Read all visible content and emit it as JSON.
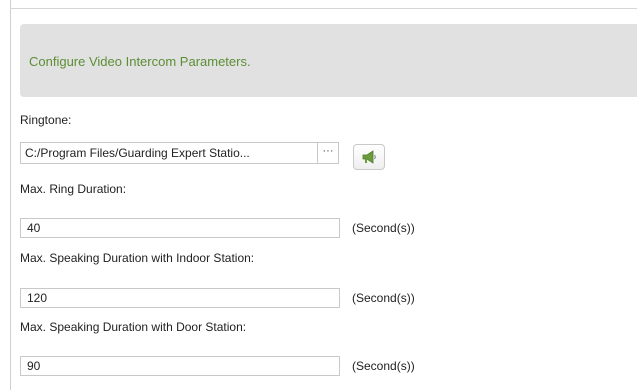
{
  "banner": {
    "title": "Configure Video Intercom Parameters."
  },
  "ringtone": {
    "label": "Ringtone:",
    "path": "C:/Program Files/Guarding Expert Statio...",
    "browse_label": "···",
    "play_icon": "megaphone-icon"
  },
  "max_ring_duration": {
    "label": "Max. Ring Duration:",
    "value": "40",
    "unit": "(Second(s))"
  },
  "indoor_speaking": {
    "label": "Max. Speaking Duration with Indoor Station:",
    "value": "120",
    "unit": "(Second(s))"
  },
  "door_speaking": {
    "label": "Max. Speaking Duration with Door Station:",
    "value": "90",
    "unit": "(Second(s))"
  },
  "colors": {
    "banner_bg": "#e1e1e1",
    "banner_text": "#5b8e35",
    "icon_green": "#6b9b3c"
  }
}
